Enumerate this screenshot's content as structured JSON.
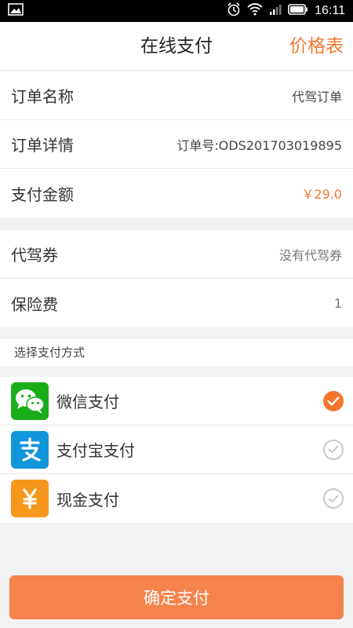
{
  "status_bar": {
    "time": "16:11",
    "icons": [
      "image-icon",
      "alarm-icon",
      "wifi-icon",
      "signal-icon",
      "battery-icon"
    ]
  },
  "header": {
    "title": "在线支付",
    "price_list_label": "价格表"
  },
  "order": [
    {
      "label": "订单名称",
      "value": "代驾订单"
    },
    {
      "label": "订单详情",
      "value": "订单号:ODS201703019895"
    },
    {
      "label": "支付金额",
      "value": "￥29.0"
    }
  ],
  "extras": [
    {
      "label": "代驾券",
      "value": "没有代驾券"
    },
    {
      "label": "保险费",
      "value": "1"
    }
  ],
  "payment": {
    "section_title": "选择支付方式",
    "methods": [
      {
        "label": "微信支付",
        "icon": "wechat-pay-icon",
        "selected": true
      },
      {
        "label": "支付宝支付",
        "icon": "alipay-icon",
        "selected": false
      },
      {
        "label": "现金支付",
        "icon": "cash-icon",
        "selected": false
      }
    ]
  },
  "colors": {
    "accent": "#f5762d",
    "wechat": "#1aad19",
    "alipay": "#1296db",
    "cash": "#f7961c"
  },
  "confirm_label": "确定支付"
}
